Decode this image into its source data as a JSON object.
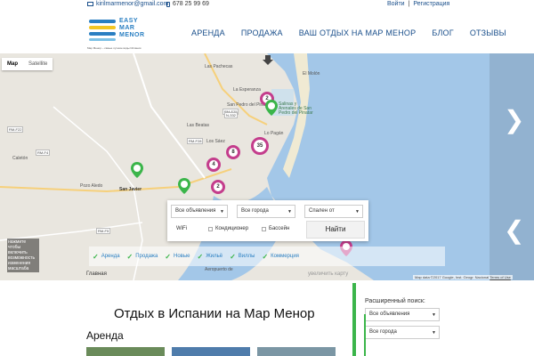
{
  "topbar": {
    "email": "kirilmarmenor@gmail.com",
    "phone": "678 25 99 69",
    "login": "Войти",
    "separator": "|",
    "register": "Регистрация"
  },
  "logo": {
    "line1": "EASY",
    "line2": "MAR",
    "line3": "MENOR",
    "tagline": "Мар Менор – самые лучшие виды Испании"
  },
  "nav": [
    "АРЕНДА",
    "ПРОДАЖА",
    "ВАШ ОТДЫХ НА МАР МЕНОР",
    "БЛОГ",
    "ОТЗЫВЫ"
  ],
  "map": {
    "type_map": "Map",
    "type_satellite": "Satellite",
    "places": [
      "Las Pachecas",
      "La Esperanza",
      "San Pedro del Pinatar",
      "El Molón",
      "Las Beatas",
      "Los Sáez",
      "Lo Pagán",
      "Caletón",
      "San Javier",
      "Pozo Aledo",
      "Salinas y Arenales de San Pedro del Pinatar",
      "Aeropuerto de"
    ],
    "clusters": [
      "2",
      "8",
      "35",
      "4",
      "2"
    ],
    "zoom_note": "нажмите чтобы включить возможность изменения масштаба",
    "attribution": "Map data ©2017 Google, Inst. Geogr. Nacional",
    "terms": "Terms of Use"
  },
  "filter": {
    "type": "Все объявления",
    "city": "Все города",
    "bedrooms": "Спален от",
    "wifi": "WiFi",
    "ac": "Кондиционер",
    "pool": "Бассейн",
    "search": "Найти"
  },
  "categories": [
    "Аренда",
    "Продажа",
    "Новые",
    "Жильё",
    "Виллы",
    "Коммерция"
  ],
  "bottom": {
    "crumb": "Главная",
    "enlarge": "увеличить карту",
    "heading": "Отдых в Испании на Мар Менор",
    "section": "Аренда",
    "side_title": "Расширенный поиск:",
    "side_type": "Все объявления",
    "side_city": "Все города"
  },
  "colors": {
    "accent": "#2a7fc2",
    "cluster": "#c43d8c",
    "pin": "#3bb54a",
    "sea": "#a3c7e8"
  }
}
